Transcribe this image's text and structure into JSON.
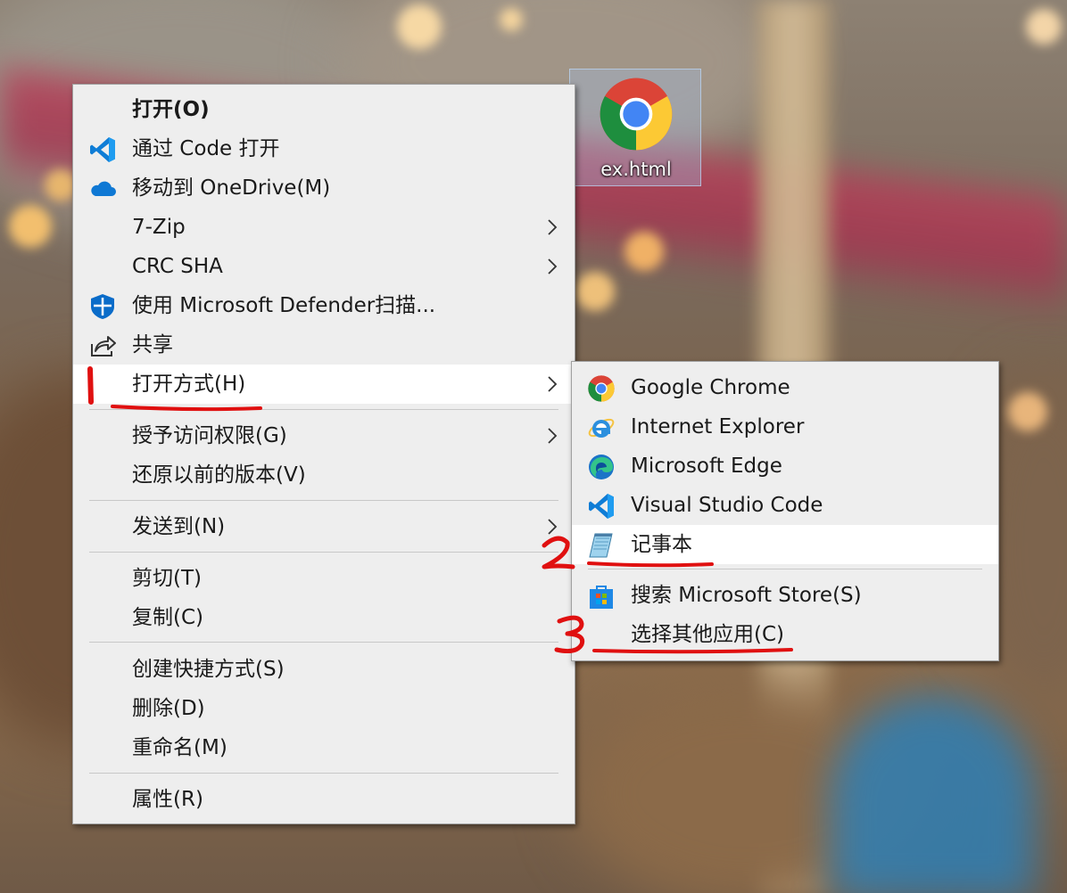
{
  "desktop": {
    "file_icon": "chrome-file-icon",
    "file_name": "ex.html"
  },
  "context_menu": {
    "items": [
      {
        "label": "打开(O)",
        "bold": true
      },
      {
        "label": "通过 Code 打开",
        "icon": "vscode-icon"
      },
      {
        "label": "移动到 OneDrive(M)",
        "icon": "onedrive-cloud-icon"
      },
      {
        "label": "7-Zip",
        "submenu": true
      },
      {
        "label": "CRC SHA",
        "submenu": true
      },
      {
        "label": "使用 Microsoft Defender扫描...",
        "icon": "defender-shield-icon"
      },
      {
        "label": "共享",
        "icon": "share-icon"
      },
      {
        "label": "打开方式(H)",
        "submenu": true,
        "highlighted": true
      },
      {
        "label": "授予访问权限(G)",
        "submenu": true
      },
      {
        "label": "还原以前的版本(V)"
      },
      {
        "label": "发送到(N)",
        "submenu": true
      },
      {
        "label": "剪切(T)"
      },
      {
        "label": "复制(C)"
      },
      {
        "label": "创建快捷方式(S)"
      },
      {
        "label": "删除(D)"
      },
      {
        "label": "重命名(M)"
      },
      {
        "label": "属性(R)"
      }
    ]
  },
  "open_with_menu": {
    "items": [
      {
        "label": "Google Chrome",
        "icon": "chrome-icon"
      },
      {
        "label": "Internet Explorer",
        "icon": "internet-explorer-icon"
      },
      {
        "label": "Microsoft Edge",
        "icon": "edge-icon"
      },
      {
        "label": "Visual Studio Code",
        "icon": "vscode-icon"
      },
      {
        "label": "记事本",
        "icon": "notepad-icon",
        "highlighted": true
      },
      {
        "label": "搜索 Microsoft Store(S)",
        "icon": "microsoft-store-icon"
      },
      {
        "label": "选择其他应用(C)"
      }
    ]
  },
  "annotations": {
    "step1": "1",
    "step2": "2",
    "step3": "3",
    "color": "#e01010"
  }
}
